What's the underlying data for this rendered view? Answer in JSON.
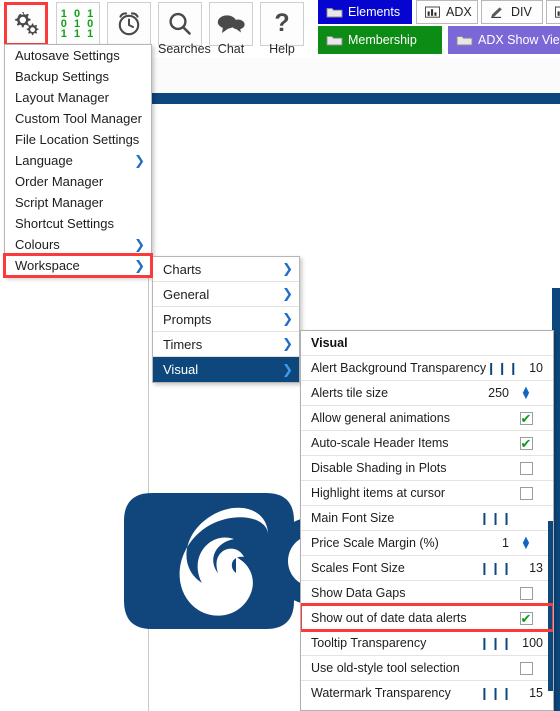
{
  "toolbar": {
    "buttons": [
      {
        "icon": "gears-icon",
        "label": "",
        "name": "settings-button",
        "selected": true
      },
      {
        "icon": "binary-icon",
        "label": "",
        "name": "binary-button",
        "selected": false
      },
      {
        "icon": "alarm-icon",
        "label": "",
        "name": "alarm-button",
        "selected": false
      },
      {
        "icon": "search-icon",
        "label": "Searches",
        "name": "searches-button",
        "selected": false
      },
      {
        "icon": "chat-icon",
        "label": "Chat",
        "name": "chat-button",
        "selected": false
      },
      {
        "icon": "help-icon",
        "label": "Help",
        "name": "help-button",
        "selected": false
      }
    ],
    "binary_rows": [
      "1 0 1",
      "0 1 0",
      "1 1 1"
    ],
    "tabs_row1": [
      {
        "label": "Elements",
        "icon": "folder-icon",
        "style": "blue"
      },
      {
        "label": "ADX",
        "icon": "bars-icon",
        "style": "plain"
      },
      {
        "label": "DIV",
        "icon": "pencil-icon",
        "style": "plain"
      },
      {
        "label": "",
        "icon": "bars-icon",
        "style": "plain"
      }
    ],
    "tabs_row2": [
      {
        "label": "Membership",
        "icon": "folder-icon",
        "style": "green"
      },
      {
        "label": "ADX Show Views",
        "icon": "folder-icon",
        "style": "purple"
      }
    ]
  },
  "menu1": {
    "items": [
      {
        "label": "Autosave Settings",
        "arrow": false,
        "highlighted": false,
        "boxed": false
      },
      {
        "label": "Backup Settings",
        "arrow": false,
        "highlighted": false,
        "boxed": false
      },
      {
        "label": "Layout Manager",
        "arrow": false,
        "highlighted": false,
        "boxed": false
      },
      {
        "label": "Custom Tool Manager",
        "arrow": false,
        "highlighted": false,
        "boxed": false
      },
      {
        "label": "File Location Settings",
        "arrow": false,
        "highlighted": false,
        "boxed": false
      },
      {
        "label": "Language",
        "arrow": true,
        "highlighted": false,
        "boxed": false
      },
      {
        "label": "Order Manager",
        "arrow": false,
        "highlighted": false,
        "boxed": false
      },
      {
        "label": "Script Manager",
        "arrow": false,
        "highlighted": false,
        "boxed": false
      },
      {
        "label": "Shortcut Settings",
        "arrow": false,
        "highlighted": false,
        "boxed": false
      },
      {
        "label": "Colours",
        "arrow": true,
        "highlighted": false,
        "boxed": false
      },
      {
        "label": "Workspace",
        "arrow": true,
        "highlighted": false,
        "boxed": true
      }
    ]
  },
  "menu2": {
    "items": [
      {
        "label": "Charts",
        "arrow": true,
        "highlighted": false
      },
      {
        "label": "General",
        "arrow": true,
        "highlighted": false
      },
      {
        "label": "Prompts",
        "arrow": true,
        "highlighted": false
      },
      {
        "label": "Timers",
        "arrow": true,
        "highlighted": false
      },
      {
        "label": "Visual",
        "arrow": true,
        "highlighted": true
      }
    ]
  },
  "visual_panel": {
    "title": "Visual",
    "rows": [
      {
        "label": "Alert Background Transparency",
        "control": "slider",
        "value": "10",
        "checked": null,
        "boxed": false
      },
      {
        "label": "Alerts tile size",
        "control": "spinner",
        "value": "250",
        "checked": null,
        "boxed": false
      },
      {
        "label": "Allow general animations",
        "control": "checkbox",
        "value": "",
        "checked": true,
        "boxed": false
      },
      {
        "label": "Auto-scale Header Items",
        "control": "checkbox",
        "value": "",
        "checked": true,
        "boxed": false
      },
      {
        "label": "Disable Shading in Plots",
        "control": "checkbox",
        "value": "",
        "checked": false,
        "boxed": false
      },
      {
        "label": "Highlight items at cursor",
        "control": "checkbox",
        "value": "",
        "checked": false,
        "boxed": false
      },
      {
        "label": "Main Font Size",
        "control": "slider",
        "value": "",
        "checked": null,
        "boxed": false
      },
      {
        "label": "Price Scale Margin (%)",
        "control": "spinner",
        "value": "1",
        "checked": null,
        "boxed": false
      },
      {
        "label": "Scales Font Size",
        "control": "slider",
        "value": "13",
        "checked": null,
        "boxed": false
      },
      {
        "label": "Show Data Gaps",
        "control": "checkbox",
        "value": "",
        "checked": false,
        "boxed": false
      },
      {
        "label": "Show out of date data alerts",
        "control": "checkbox",
        "value": "",
        "checked": true,
        "boxed": true
      },
      {
        "label": "Tooltip Transparency",
        "control": "slider",
        "value": "100",
        "checked": null,
        "boxed": false
      },
      {
        "label": "Use old-style tool selection",
        "control": "checkbox",
        "value": "",
        "checked": false,
        "boxed": false
      },
      {
        "label": "Watermark Transparency",
        "control": "slider",
        "value": "15",
        "checked": null,
        "boxed": false
      }
    ]
  },
  "colors": {
    "accent_navy": "#0d477c",
    "highlight_red": "#fb3b3b",
    "tick_green": "#0a9a1e",
    "tab_blue": "#0505cf",
    "tab_green": "#0c8c14",
    "tab_purple": "#7b68d6"
  }
}
